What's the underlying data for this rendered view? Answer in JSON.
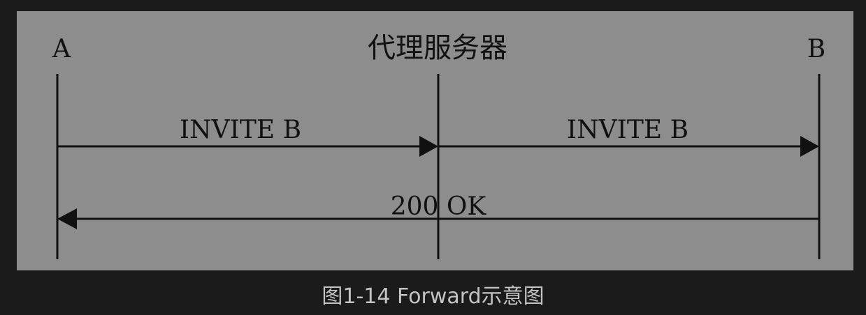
{
  "diagram": {
    "participants": [
      {
        "id": "a",
        "label": "A"
      },
      {
        "id": "proxy",
        "label": "代理服务器"
      },
      {
        "id": "b",
        "label": "B"
      }
    ],
    "messages": [
      {
        "label": "INVITE B",
        "from": "a",
        "to": "proxy"
      },
      {
        "label": "INVITE B",
        "from": "proxy",
        "to": "b"
      },
      {
        "label": "200 OK",
        "from": "b",
        "to": "a"
      }
    ],
    "colors": {
      "panel": "#8d8d8d",
      "line": "#111111",
      "background": "#1b1b1b",
      "caption": "#c4c4c4"
    }
  },
  "caption": "图1-14 Forward示意图"
}
